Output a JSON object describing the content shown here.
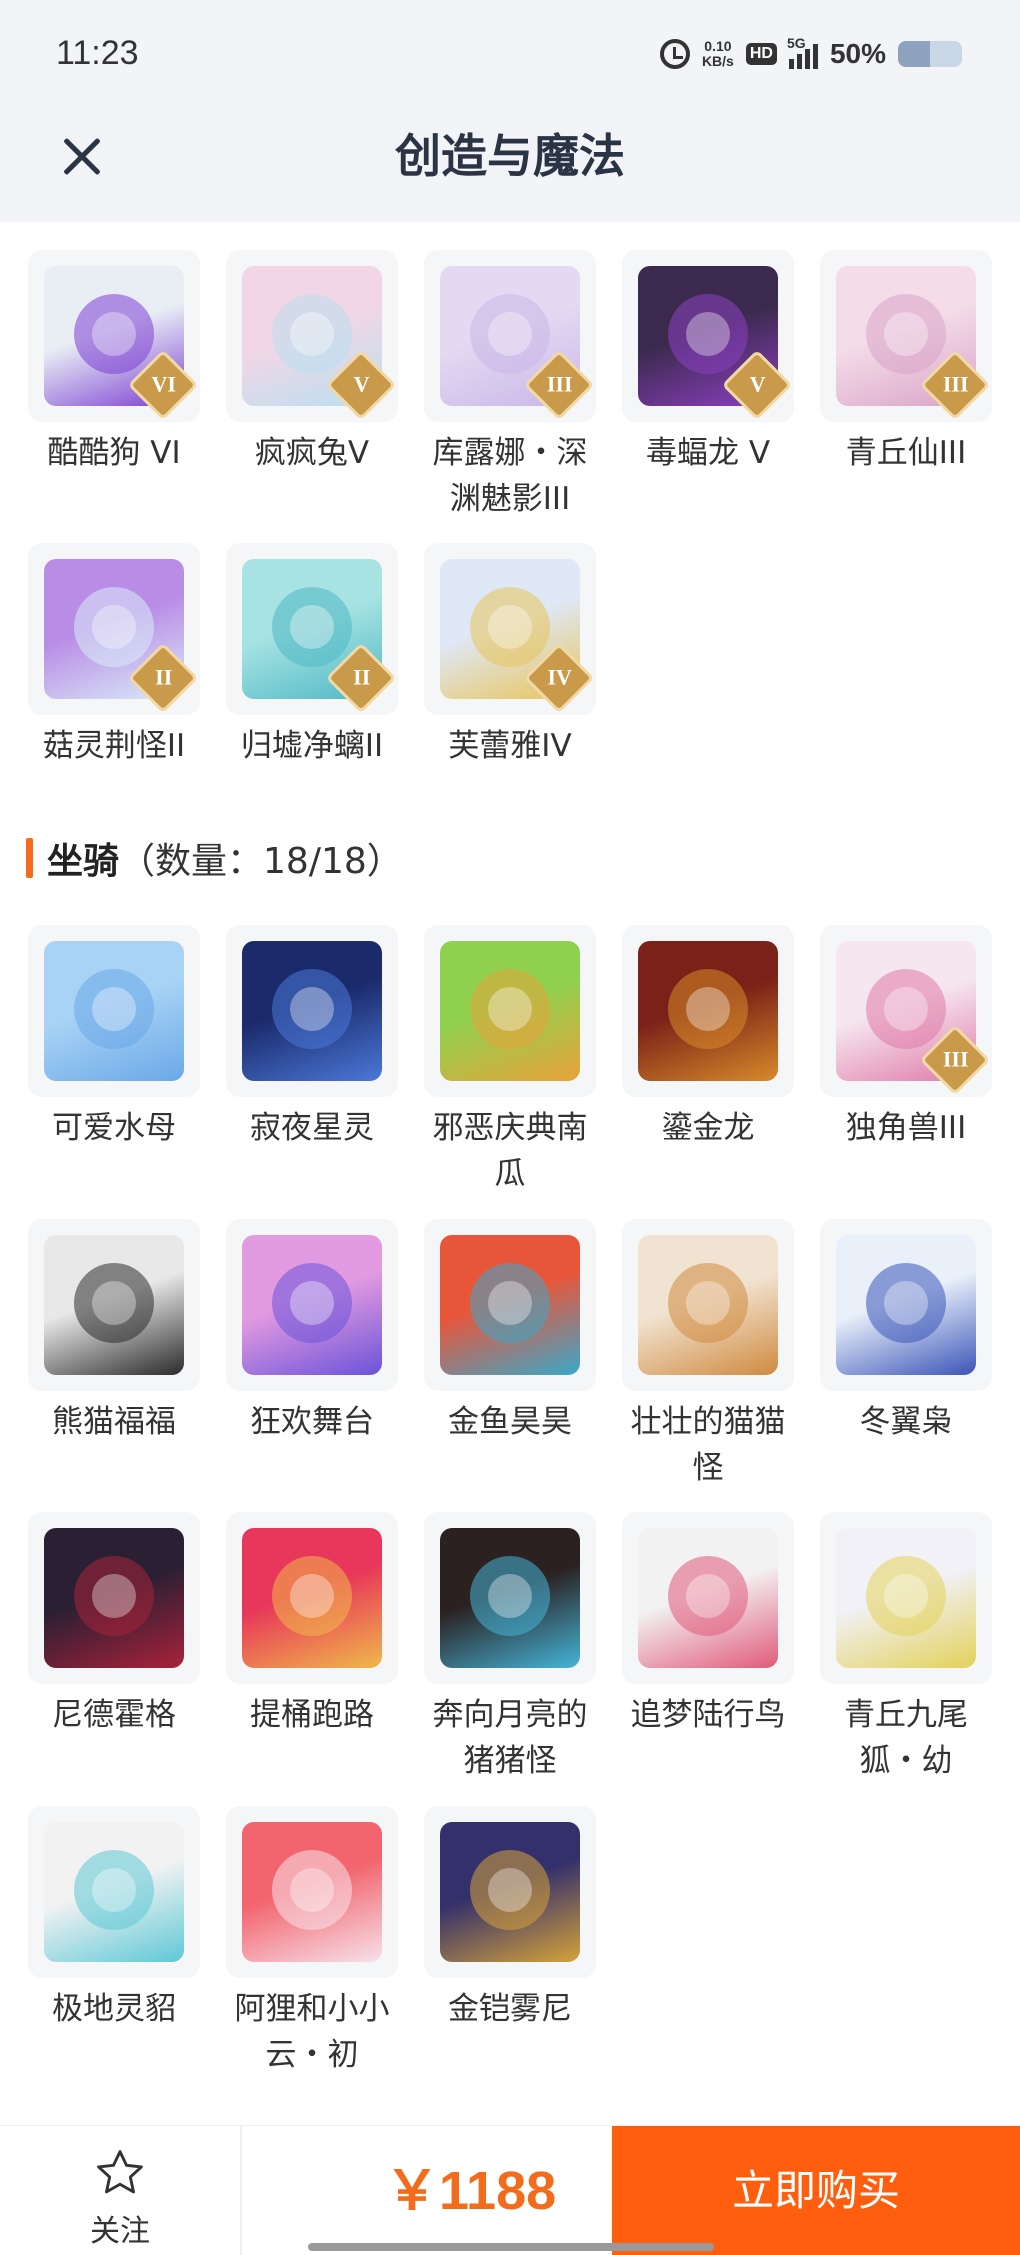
{
  "status_bar": {
    "time": "11:23",
    "speed_value": "0.10",
    "speed_unit": "KB/s",
    "hd": "HD",
    "network": "5G",
    "battery_text": "50%",
    "battery_level": 0.5
  },
  "header": {
    "title": "创造与魔法",
    "close_icon": "close-icon"
  },
  "pets_partial": [
    {
      "name": "酷酷狗 VI",
      "badge": "VI",
      "colors": [
        "#e9eef5",
        "#7b3fd1"
      ]
    },
    {
      "name": "疯疯兔V",
      "badge": "V",
      "colors": [
        "#f3d6e6",
        "#b8e0ef"
      ]
    },
    {
      "name": "库露娜・深渊魅影III",
      "badge": "III",
      "colors": [
        "#e4d9f2",
        "#c9b7e8"
      ]
    },
    {
      "name": "毒蝠龙 V",
      "badge": "V",
      "colors": [
        "#3b2a4d",
        "#8d3fc2"
      ]
    },
    {
      "name": "青丘仙III",
      "badge": "III",
      "colors": [
        "#f4dce8",
        "#d9a4c9"
      ]
    },
    {
      "name": "菇灵荆怪II",
      "badge": "II",
      "colors": [
        "#b98ce6",
        "#d9ecf7"
      ]
    },
    {
      "name": "归墟净螭II",
      "badge": "II",
      "colors": [
        "#a7e3e3",
        "#4fb8c4"
      ]
    },
    {
      "name": "芙蕾雅IV",
      "badge": "IV",
      "colors": [
        "#dfe8f7",
        "#e8c45a"
      ]
    }
  ],
  "mounts_section": {
    "title": "坐骑",
    "count_text": "（数量：18/18）"
  },
  "mounts": [
    {
      "name": "可爱水母",
      "badge": "",
      "colors": [
        "#a9d3f5",
        "#6aa8e8"
      ]
    },
    {
      "name": "寂夜星灵",
      "badge": "",
      "colors": [
        "#1b2a6b",
        "#4b78d9"
      ]
    },
    {
      "name": "邪恶庆典南瓜",
      "badge": "",
      "colors": [
        "#8fd14f",
        "#e8a23a"
      ]
    },
    {
      "name": "鎏金龙",
      "badge": "",
      "colors": [
        "#7a2218",
        "#d88a2a"
      ]
    },
    {
      "name": "独角兽III",
      "badge": "III",
      "colors": [
        "#f5e6ef",
        "#e07aa8"
      ]
    },
    {
      "name": "熊猫福福",
      "badge": "",
      "colors": [
        "#e8e8e8",
        "#2b2b2b"
      ]
    },
    {
      "name": "狂欢舞台",
      "badge": "",
      "colors": [
        "#e29ae0",
        "#6b53d9"
      ]
    },
    {
      "name": "金鱼昊昊",
      "badge": "",
      "colors": [
        "#e8563a",
        "#3aa8c9"
      ]
    },
    {
      "name": "壮壮的猫猫怪",
      "badge": "",
      "colors": [
        "#f1e3d2",
        "#d08a3e"
      ]
    },
    {
      "name": "冬翼枭",
      "badge": "",
      "colors": [
        "#e9f0fa",
        "#3b55b8"
      ]
    },
    {
      "name": "尼德霍格",
      "badge": "",
      "colors": [
        "#2a1f33",
        "#a8223b"
      ]
    },
    {
      "name": "提桶跑路",
      "badge": "",
      "colors": [
        "#e8375a",
        "#f0b84a"
      ]
    },
    {
      "name": "奔向月亮的猪猪怪",
      "badge": "",
      "colors": [
        "#2b2121",
        "#45b5d9"
      ]
    },
    {
      "name": "追梦陆行鸟",
      "badge": "",
      "colors": [
        "#f2f2f2",
        "#e05a7a"
      ]
    },
    {
      "name": "青丘九尾狐・幼",
      "badge": "",
      "colors": [
        "#f1f1f7",
        "#e3d15a"
      ]
    },
    {
      "name": "极地灵貂",
      "badge": "",
      "colors": [
        "#f2f2f2",
        "#5ec8d6"
      ]
    },
    {
      "name": "阿狸和小小云・初",
      "badge": "",
      "colors": [
        "#f2656e",
        "#f7e1ea"
      ]
    },
    {
      "name": "金铠雾尼",
      "badge": "",
      "colors": [
        "#34306b",
        "#d5a23b"
      ]
    }
  ],
  "bottom_bar": {
    "follow_label": "关注",
    "price": "￥1188",
    "buy_label": "立即购买"
  }
}
